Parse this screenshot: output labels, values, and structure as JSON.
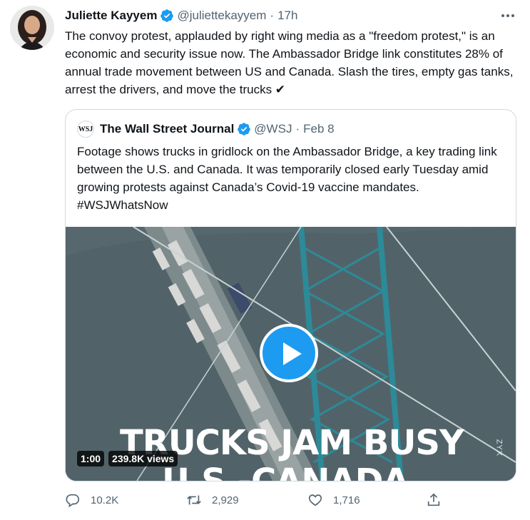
{
  "tweet": {
    "author_name": "Juliette Kayyem",
    "handle": "@juliettekayyem",
    "separator": "·",
    "time": "17h",
    "text": "The convoy protest, applauded by right wing media as a \"freedom protest,\" is an economic and security issue now. The Ambassador Bridge link constitutes 28% of annual trade movement between US and Canada. Slash the tires, empty gas tanks, arrest the drivers, and move the trucks ✔"
  },
  "quote": {
    "logo_text": "WSJ",
    "author_name": "The Wall Street Journal",
    "handle": "@WSJ",
    "separator": "·",
    "date": "Feb 8",
    "text": "Footage shows trucks in gridlock on the Ambassador Bridge, a key trading link between the U.S. and Canada. It was temporarily closed early Tuesday amid growing protests against Canada’s Covid-19 vaccine mandates. #WSJWhatsNow",
    "video": {
      "caption_line1": "TRUCKS JAM BUSY",
      "caption_line2": "U.S.-CANADA",
      "watermark": "ZYX",
      "duration": "1:00",
      "views": "239.8K views"
    }
  },
  "actions": {
    "replies": "10.2K",
    "retweets": "2,929",
    "likes": "1,716"
  },
  "icons": {
    "verified": "verified-badge-icon",
    "more": "more-icon",
    "reply": "reply-icon",
    "retweet": "retweet-icon",
    "like": "heart-icon",
    "share": "share-icon",
    "play": "play-icon"
  },
  "colors": {
    "accent": "#1d9bf0",
    "text": "#0f1419",
    "secondary": "#536471",
    "border": "#cfd9de"
  }
}
